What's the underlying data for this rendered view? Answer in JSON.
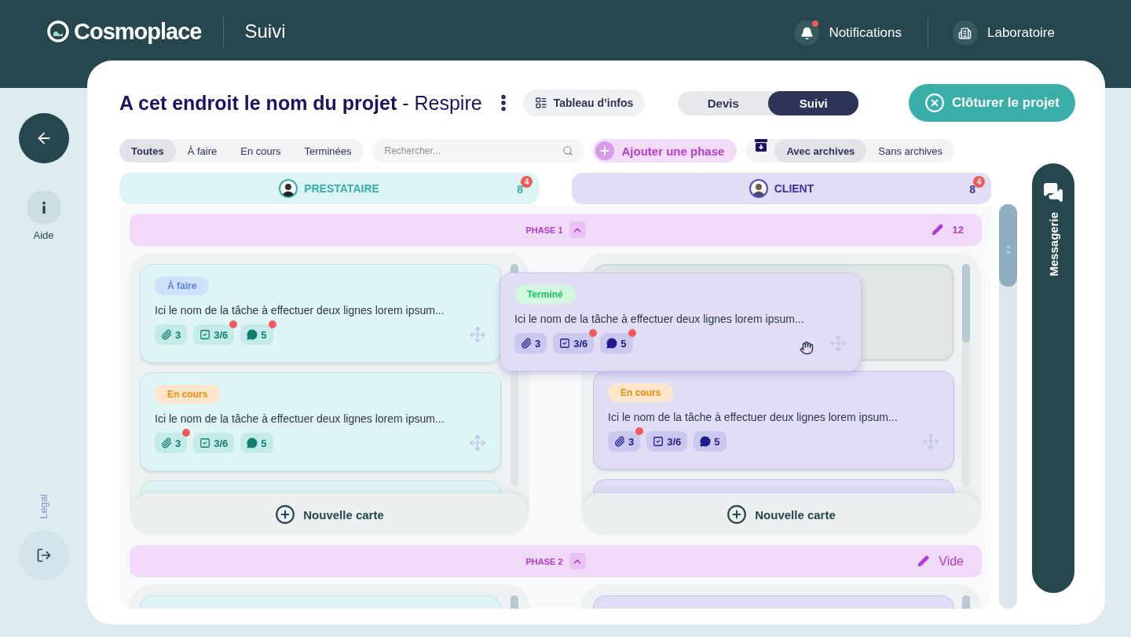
{
  "header": {
    "brand": "Cosmoplace",
    "section": "Suivi",
    "notifications": {
      "label": "Notifications",
      "unread": true
    },
    "account": {
      "label": "Laboratoire"
    }
  },
  "sidebar": {
    "help_label": "Aide",
    "legal_link": "Legal"
  },
  "project": {
    "title": "**A cet endroit le nom du projet** - Respire",
    "info_button": "Tableau d’infos"
  },
  "mode_tabs": [
    {
      "label": "Devis",
      "selected": false
    },
    {
      "label": "Suivi",
      "selected": true
    }
  ],
  "close_button": "Clôturer le projet",
  "status_filters": [
    {
      "label": "Toutes",
      "selected": true
    },
    {
      "label": "À faire",
      "selected": false
    },
    {
      "label": "En cours",
      "selected": false
    },
    {
      "label": "Terminées",
      "selected": false
    }
  ],
  "search": {
    "placeholder": "Rechercher..."
  },
  "add_phase_button": "Ajouter une phase",
  "archive_filters": [
    {
      "label": "Avec archives",
      "selected": true
    },
    {
      "label": "Sans archives",
      "selected": false
    }
  ],
  "columns": [
    {
      "kind": "provider",
      "title": "PRESTATAIRE",
      "count": "8",
      "badge": "4"
    },
    {
      "kind": "client",
      "title": "CLIENT",
      "count": "8",
      "badge": "4"
    }
  ],
  "phases": [
    {
      "title": "PHASE 1",
      "expanded": true,
      "summary": {
        "kind": "count",
        "text": "12"
      },
      "lanes": [
        {
          "kind": "provider",
          "new_card_button": "Nouvelle carte",
          "cards": [
            {
              "kind": "task",
              "status": {
                "kind": "todo",
                "label": "À faire"
              },
              "text": "Ici le nom de la tâche à effectuer deux lignes lorem ipsum...",
              "chips": [
                {
                  "kind": "attachments",
                  "value": "3",
                  "notified": false
                },
                {
                  "kind": "tasks",
                  "value": "3/6",
                  "notified": true
                },
                {
                  "kind": "comments",
                  "value": "5",
                  "notified": true
                }
              ]
            },
            {
              "kind": "task",
              "status": {
                "kind": "progress",
                "label": "En cours"
              },
              "text": "Ici le nom de la tâche à effectuer deux lignes lorem ipsum...",
              "chips": [
                {
                  "kind": "attachments",
                  "value": "3",
                  "notified": true
                },
                {
                  "kind": "tasks",
                  "value": "3/6",
                  "notified": false
                },
                {
                  "kind": "comments",
                  "value": "5",
                  "notified": false
                }
              ]
            },
            {
              "kind": "stub"
            }
          ]
        },
        {
          "kind": "client",
          "new_card_button": "Nouvelle carte",
          "cards": [
            {
              "kind": "drop_zone"
            },
            {
              "kind": "task",
              "status": {
                "kind": "progress",
                "label": "En cours"
              },
              "text": "Ici le nom de la tâche à effectuer deux lignes lorem ipsum...",
              "chips": [
                {
                  "kind": "attachments",
                  "value": "3",
                  "notified": true
                },
                {
                  "kind": "tasks",
                  "value": "3/6",
                  "notified": false
                },
                {
                  "kind": "comments",
                  "value": "5",
                  "notified": false
                }
              ]
            },
            {
              "kind": "stub"
            }
          ],
          "dragged_card": {
            "status": {
              "kind": "done",
              "label": "Terminé"
            },
            "text": "Ici le nom de la tâche à effectuer deux lignes lorem ipsum...",
            "chips": [
              {
                "kind": "attachments",
                "value": "3",
                "notified": false
              },
              {
                "kind": "tasks",
                "value": "3/6",
                "notified": true
              },
              {
                "kind": "comments",
                "value": "5",
                "notified": true
              }
            ]
          }
        }
      ]
    },
    {
      "title": "PHASE 2",
      "expanded": true,
      "summary": {
        "kind": "empty",
        "text": "Vide"
      },
      "lanes": [
        {
          "kind": "provider",
          "cards": [
            {
              "kind": "stub"
            }
          ]
        },
        {
          "kind": "client",
          "cards": [
            {
              "kind": "stub"
            }
          ]
        }
      ]
    }
  ],
  "messaging": {
    "label": "Messagerie"
  }
}
